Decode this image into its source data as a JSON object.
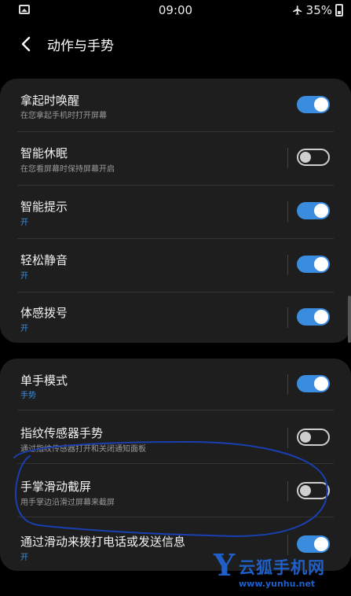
{
  "status_bar": {
    "time": "09:00",
    "battery": "35%",
    "icons": [
      "image-icon",
      "airplane-icon",
      "battery-icon"
    ]
  },
  "header": {
    "title": "动作与手势",
    "back_icon": "chevron-left-icon"
  },
  "group1": [
    {
      "label": "拿起时唤醒",
      "sub": "在您拿起手机时打开屏幕",
      "toggle": "on"
    },
    {
      "label": "智能休眠",
      "sub": "在您看屏幕时保持屏幕开启",
      "toggle": "off"
    },
    {
      "label": "智能提示",
      "sub": "开",
      "toggle": "on"
    },
    {
      "label": "轻松静音",
      "sub": "开",
      "toggle": "on"
    },
    {
      "label": "体感拨号",
      "sub": "开",
      "toggle": "on"
    }
  ],
  "group2": [
    {
      "label": "单手模式",
      "sub": "手势",
      "toggle": "on"
    },
    {
      "label": "指纹传感器手势",
      "sub": "通过指纹传感器打开和关闭通知面板",
      "toggle": "off"
    },
    {
      "label": "手掌滑动截屏",
      "sub": "用手掌边沿滑过屏幕来截屏",
      "toggle": "off"
    },
    {
      "label": "通过滑动来拨打电话或发送信息",
      "sub": "开",
      "toggle": "on"
    }
  ],
  "watermark": {
    "letter": "Y",
    "name": "云狐手机网",
    "url": "www.yunhu.net"
  },
  "colors": {
    "accent": "#3a8dde",
    "card": "#1e1e1e",
    "annotation": "#1a3fb0",
    "watermark": "#1f5fc7"
  }
}
